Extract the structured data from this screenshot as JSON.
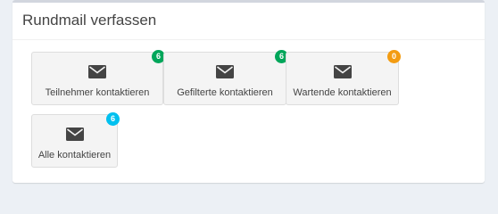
{
  "panel": {
    "title": "Rundmail verfassen"
  },
  "buttons": [
    {
      "label": "Teilnehmer kontaktieren",
      "count": "6",
      "badge_color": "#00a65a",
      "icon": "envelope-icon"
    },
    {
      "label": "Gefilterte kontaktieren",
      "count": "6",
      "badge_color": "#00a65a",
      "icon": "envelope-icon"
    },
    {
      "label": "Wartende kontaktieren",
      "count": "0",
      "badge_color": "#f39c12",
      "icon": "envelope-icon"
    },
    {
      "label": "Alle kontaktieren",
      "count": "6",
      "badge_color": "#00c0ef",
      "icon": "envelope-icon"
    }
  ]
}
